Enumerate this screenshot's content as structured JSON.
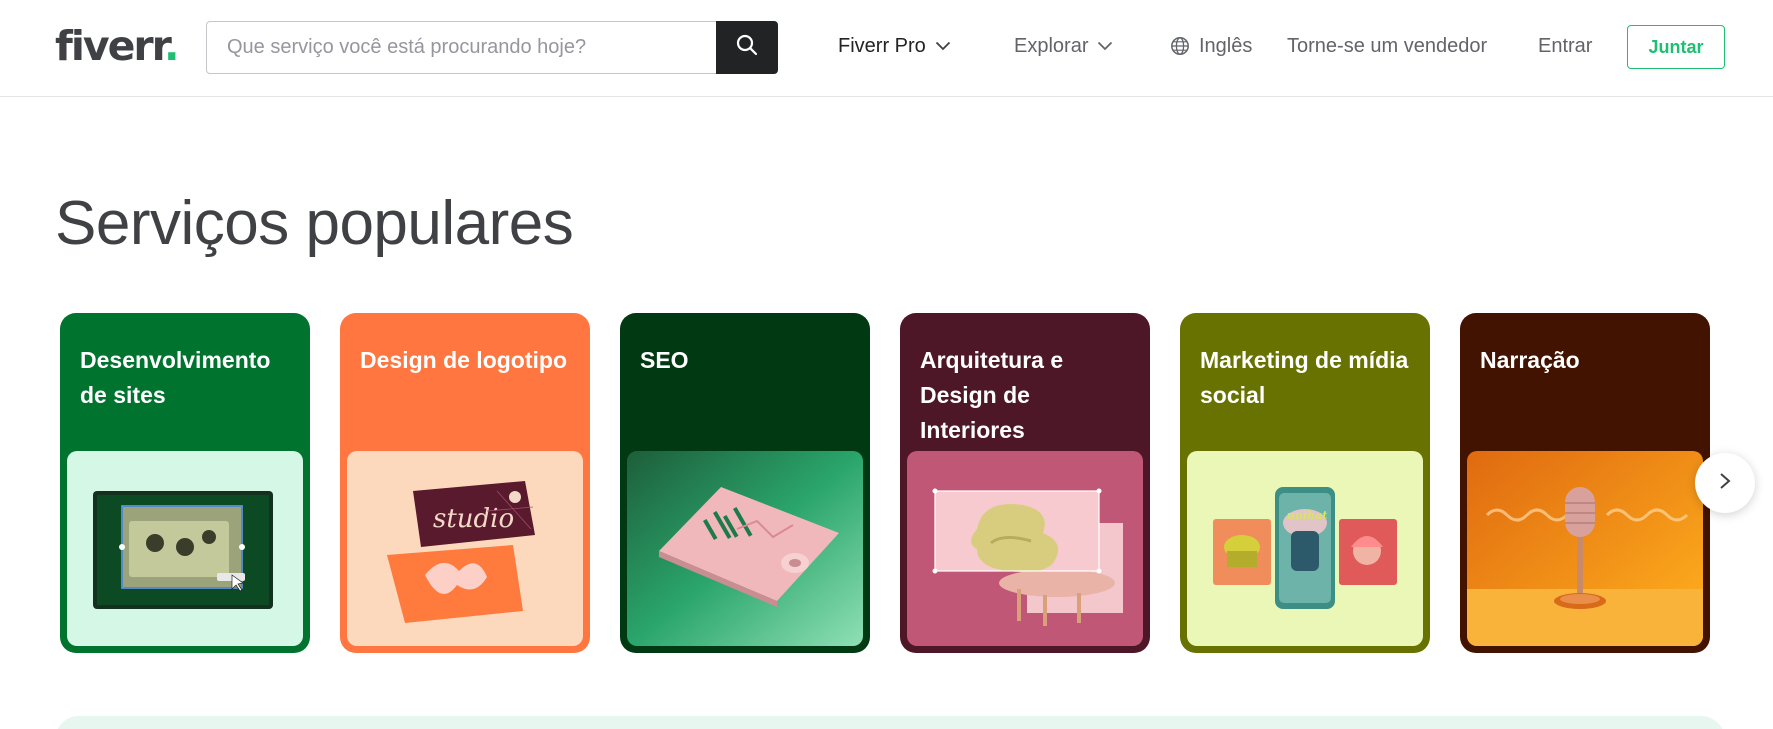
{
  "header": {
    "logo_text": "fiverr",
    "logo_dot": ".",
    "search": {
      "placeholder": "Que serviço você está procurando hoje?",
      "value": "",
      "button_icon": "search-icon"
    },
    "nav": {
      "fiverr_pro": "Fiverr Pro",
      "explore": "Explorar",
      "language": "Inglês",
      "become_seller": "Torne-se um vendedor",
      "sign_in": "Entrar",
      "join": "Juntar"
    },
    "icons": {
      "dropdown": "chevron-down-icon",
      "language": "globe-icon"
    }
  },
  "main": {
    "section_title": "Serviços populares",
    "cards": [
      {
        "label": "Desenvolvimento de sites",
        "color": "#00732e",
        "image_bg": "#d4f7e6"
      },
      {
        "label": "Design de logotipo",
        "color": "#ff7640",
        "image_bg": "#fcd9bc"
      },
      {
        "label": "SEO",
        "color": "#003912",
        "image_bg": "#2e8a5a"
      },
      {
        "label": "Arquitetura e Design de Interiores",
        "color": "#4d1727",
        "image_bg": "#c05777"
      },
      {
        "label": "Marketing de mídia social",
        "color": "#687200",
        "image_bg": "#eaf7b6"
      },
      {
        "label": "Narração",
        "color": "#421300",
        "image_bg": "#f39a1c"
      }
    ],
    "carousel_next_icon": "chevron-right-icon"
  },
  "colors": {
    "brand_green": "#1dbf73",
    "text_dark": "#404145",
    "search_button": "#222325"
  }
}
